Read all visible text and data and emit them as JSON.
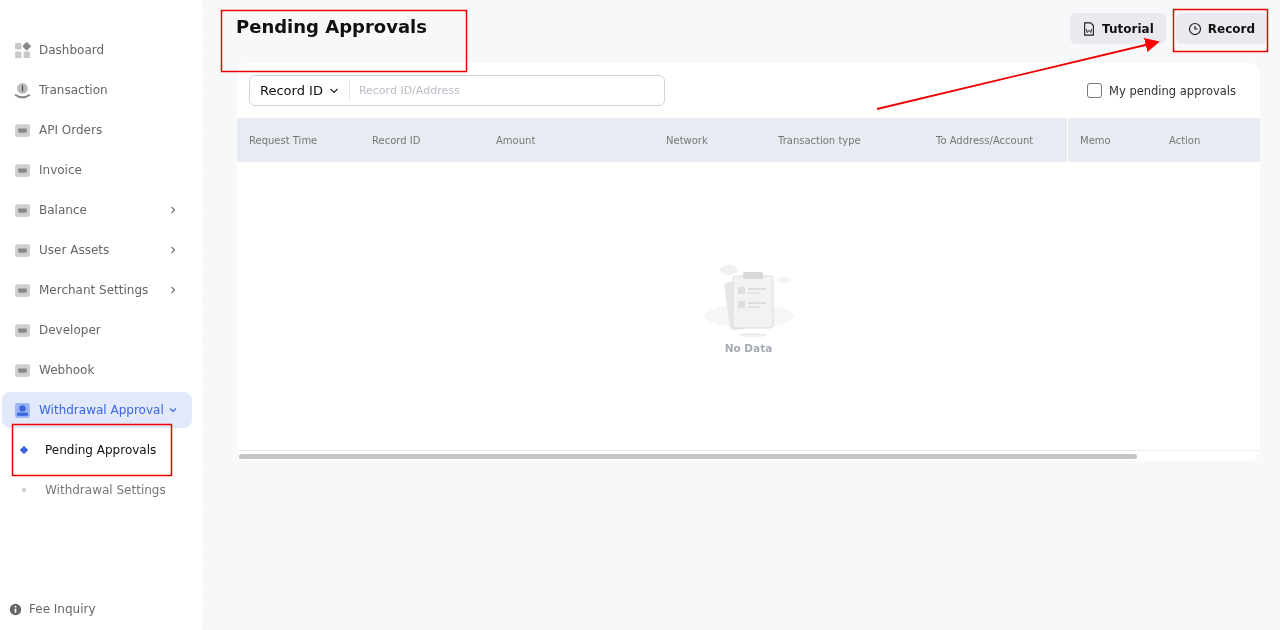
{
  "sidebar": {
    "items": [
      {
        "label": "Dashboard",
        "selected": false
      },
      {
        "label": "Transaction",
        "selected": false
      },
      {
        "label": "API Orders",
        "selected": false
      },
      {
        "label": "Invoice",
        "selected": false
      },
      {
        "label": "Balance",
        "expanded": false,
        "selected": false
      },
      {
        "label": "User Assets",
        "expanded": false,
        "selected": false
      },
      {
        "label": "Merchant Settings",
        "expanded": false,
        "selected": false
      },
      {
        "label": "Developer",
        "selected": false
      },
      {
        "label": "Webhook",
        "selected": false
      },
      {
        "label": "Withdrawal Approval",
        "expanded": true,
        "selected": true,
        "children": [
          {
            "label": "Pending Approvals",
            "selected": true
          },
          {
            "label": "Withdrawal Settings",
            "selected": false
          }
        ]
      }
    ],
    "footer": "Fee Inquiry"
  },
  "page": {
    "title": "Pending Approvals",
    "buttons": [
      "Tutorial",
      "Record"
    ]
  },
  "filter": {
    "field_select": "Record ID",
    "placeholder": "Record ID/Address",
    "my_pending": {
      "label": "My pending approvals",
      "checked": false
    }
  },
  "table": {
    "columns": [
      "Request Time",
      "Record ID",
      "Amount",
      "Network",
      "Transaction type",
      "To Address/Account",
      "Memo",
      "Action"
    ],
    "empty_text": "No Data"
  }
}
